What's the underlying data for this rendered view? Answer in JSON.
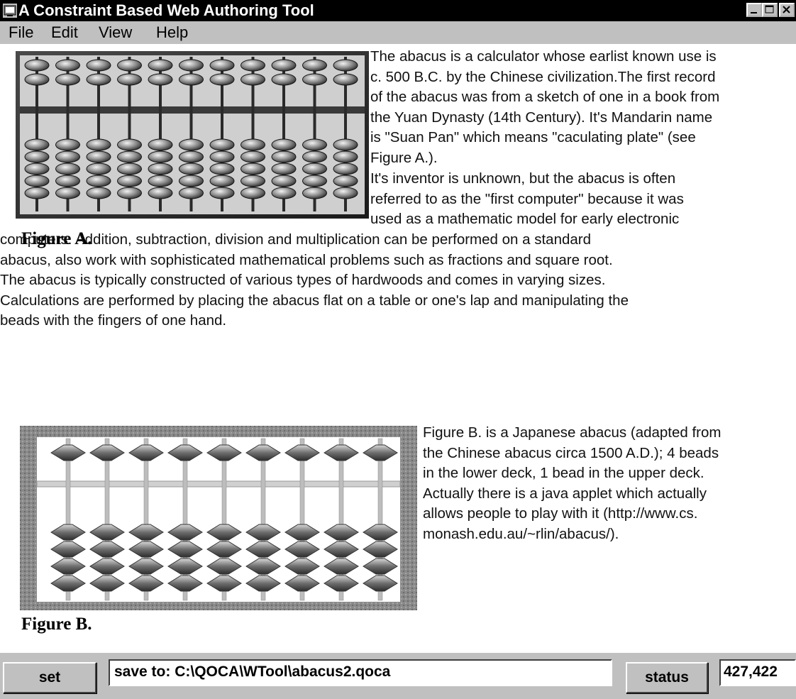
{
  "window": {
    "title": "A Constraint Based Web Authoring Tool"
  },
  "menu": [
    "File",
    "Edit",
    "View",
    "Help"
  ],
  "content": {
    "para1_lines": [
      "The abacus is a calculator whose earlist known use is",
      " c. 500 B.C. by the Chinese civilization.The first record",
      "of the abacus was from a sketch of one in a book from",
      " the Yuan Dynasty (14th Century). It's Mandarin name",
      "is \"Suan Pan\" which means \"caculating plate\" (see",
      "Figure A.)."
    ],
    "para2_lines": [
      "It's inventor is unknown, but the abacus is often",
      "referred to as the \"first computer\" because it was",
      "used as a mathematic model for early electronic"
    ],
    "para2_full_lines": [
      "computers. Addition, subtraction, division and multiplication can be performed on a standard",
      "abacus, also work with sophisticated mathematical problems such as fractions and square root.",
      "The abacus is typically constructed of various types of hardwoods and comes in varying sizes.",
      "Calculations are performed by placing the abacus flat on a table or one's lap and manipulating the",
      "beads with the fingers of one hand."
    ],
    "para3_lines": [
      "Figure B. is a Japanese abacus (adapted from",
      " the Chinese abacus circa 1500 A.D.); 4 beads",
      "in the lower deck, 1 bead in the upper deck.",
      "Actually there is a java applet which actually",
      "allows people to play with it (http://www.cs.",
      "monash.edu.au/~rlin/abacus/)."
    ],
    "figure_a_caption": "Figure A.",
    "figure_b_caption": "Figure B."
  },
  "bottom": {
    "set_label": "set",
    "save_path": "save to: C:\\QOCA\\WTool\\abacus2.qoca",
    "status_label": "status",
    "coordinates": "427,422"
  },
  "icons": {
    "app": "app-icon",
    "minimize": "minimize-icon",
    "maximize": "maximize-icon",
    "close": "close-icon"
  }
}
